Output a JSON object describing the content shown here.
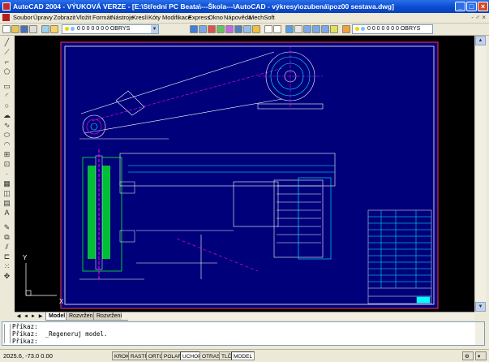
{
  "window": {
    "title": "AutoCAD 2004 - VÝUKOVÁ VERZE - [E:\\Střední PC Beata\\---Škola---\\AutoCAD - výkresy\\ozubená\\poz00 sestava.dwg]",
    "minimize_icon": "minimize-icon",
    "maximize_icon": "restore-icon",
    "close_icon": "close-icon"
  },
  "menubar": {
    "items": [
      "Soubor",
      "Úpravy",
      "Zobrazit",
      "Vložit",
      "Formát",
      "Nástroje",
      "Kreslí",
      "Kóty",
      "Modifikace",
      "Express",
      "Okno",
      "Nápověda",
      "MechSoft"
    ],
    "right_controls": "- ♂ ×"
  },
  "toolbar": {
    "layer_select": "0 0 0 0 0 0 0 OBRYS",
    "layer_select2": "0 0 0 0 0 0 0 OBRYS"
  },
  "tabs": {
    "model": "Model",
    "layout1": "Rozvržení1",
    "layout2": "Rozvržení2"
  },
  "command": {
    "lines": [
      "Příkaz:",
      "Příkaz:  _Regeneruj model.",
      "Příkaz:"
    ]
  },
  "status": {
    "coords": "2025.6, -73.0  0.00",
    "buttons": [
      "KROK",
      "RASTR",
      "ORTO",
      "POLAR",
      "UCHOP",
      "OTRAS",
      "TLČ",
      "MODEL"
    ],
    "active": [
      "UCHOP",
      "MODEL"
    ]
  },
  "drawing": {
    "background": "#000000",
    "sheet_fill": "#00007a",
    "border_color": "#ff3355",
    "frame_color": "#ffffff",
    "accent_cyan": "#00ffff",
    "accent_green": "#00ff22",
    "accent_magenta": "#ff00ff",
    "ucs_x": "X",
    "ucs_y": "Y"
  }
}
